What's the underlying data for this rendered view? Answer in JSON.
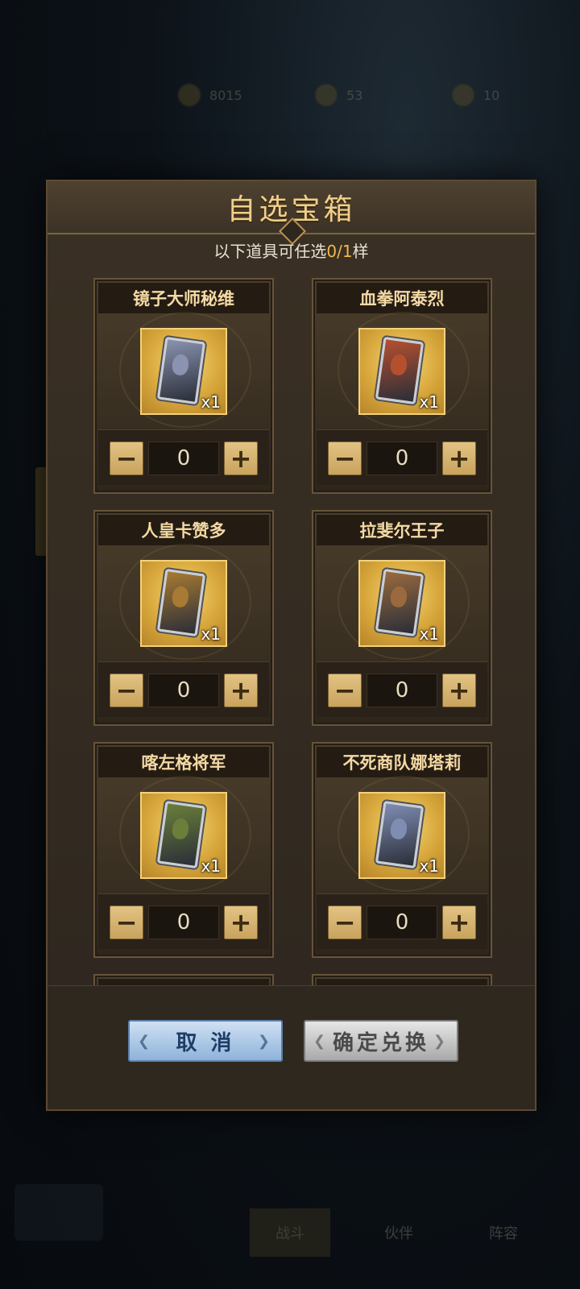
{
  "background": {
    "currencies": [
      {
        "icon": "gold-coin-icon",
        "value": "8015"
      },
      {
        "icon": "gem-icon",
        "value": "53"
      },
      {
        "icon": "ticket-icon",
        "value": "10"
      }
    ],
    "bottom_nav": [
      "战斗",
      "伙伴",
      "阵容"
    ]
  },
  "modal": {
    "title": "自选宝箱",
    "subtitle_prefix": "以下道具可任选",
    "subtitle_count": "0/1",
    "subtitle_suffix": "样"
  },
  "items": [
    {
      "name": "镜子大师秘维",
      "qty": "x1",
      "count": "0",
      "art": "#8a93b0"
    },
    {
      "name": "血拳阿泰烈",
      "qty": "x1",
      "count": "0",
      "art": "#b5502f"
    },
    {
      "name": "人皇卡赞多",
      "qty": "x1",
      "count": "0",
      "art": "#a87a33"
    },
    {
      "name": "拉斐尔王子",
      "qty": "x1",
      "count": "0",
      "art": "#9a6a3e"
    },
    {
      "name": "喀左格将军",
      "qty": "x1",
      "count": "0",
      "art": "#6b7f3a"
    },
    {
      "name": "不死商队娜塔莉",
      "qty": "x1",
      "count": "0",
      "art": "#7f8db3"
    }
  ],
  "footer": {
    "cancel_label": "取 消",
    "confirm_label": "确定兑换"
  },
  "colors": {
    "accent_gold": "#f0b94a",
    "cancel_blue": "#8fb3da",
    "confirm_gray": "#a9a9a9"
  }
}
